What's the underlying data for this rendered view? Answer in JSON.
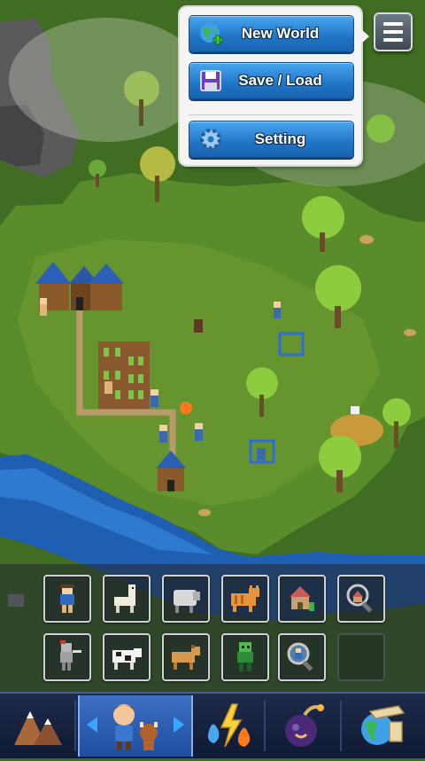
{
  "menu": {
    "items": [
      {
        "id": "new-world",
        "label": "New World",
        "icon": "globe-plus-icon"
      },
      {
        "id": "save-load",
        "label": "Save / Load",
        "icon": "floppy-disk-icon"
      },
      {
        "id": "setting",
        "label": "Setting",
        "icon": "gear-icon"
      }
    ],
    "toggle_icon": "hamburger-menu-icon"
  },
  "tool_panel": {
    "row1": [
      "human-icon",
      "llama-icon",
      "sheep-icon",
      "cat-icon",
      "house-icon",
      "magnifier-house-icon"
    ],
    "row2": [
      "knight-icon",
      "cow-icon",
      "dog-icon",
      "zombie-icon",
      "magnifier-human-icon",
      "empty-slot"
    ]
  },
  "bottom_bar": {
    "tabs": [
      {
        "id": "terrain",
        "icon": "mountains-icon"
      },
      {
        "id": "creatures",
        "icon": "villager-and-cow-icon",
        "active": true
      },
      {
        "id": "powers",
        "icon": "lightning-fire-water-icon"
      },
      {
        "id": "bombs",
        "icon": "bomb-icon"
      },
      {
        "id": "world-scroll",
        "icon": "globe-scroll-icon"
      }
    ]
  },
  "colors": {
    "grass_dark": "#3f6b22",
    "grass_light": "#5e8f2c",
    "water": "#1e5fb0",
    "stone": "#5a5a5a",
    "button_blue": "#1f74c6",
    "panel_bg": "#f4f4f4"
  }
}
